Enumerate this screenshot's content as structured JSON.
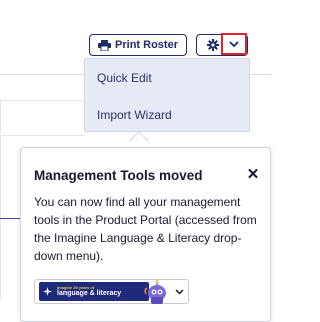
{
  "toolbar": {
    "print_label": "Print Roster",
    "print_icon": "printer-icon",
    "settings_icon": "gear-icon",
    "caret_icon": "chevron-down-icon",
    "highlight_color": "#e0222e"
  },
  "dropdown": {
    "items": [
      {
        "label": "Quick Edit"
      },
      {
        "label": "Import Wizard"
      }
    ]
  },
  "tooltip": {
    "title": "Management Tools moved",
    "close_icon": "close-icon",
    "body": "You can now find all your management tools in the Product Portal (accessed from the Imagine Language & Literacy drop-down menu)."
  },
  "product_selector": {
    "logo_small_text": "imagine 20 years of",
    "logo_main_text": "language & literacy",
    "brand_color": "#202a7d",
    "caret_icon": "chevron-down-icon"
  }
}
